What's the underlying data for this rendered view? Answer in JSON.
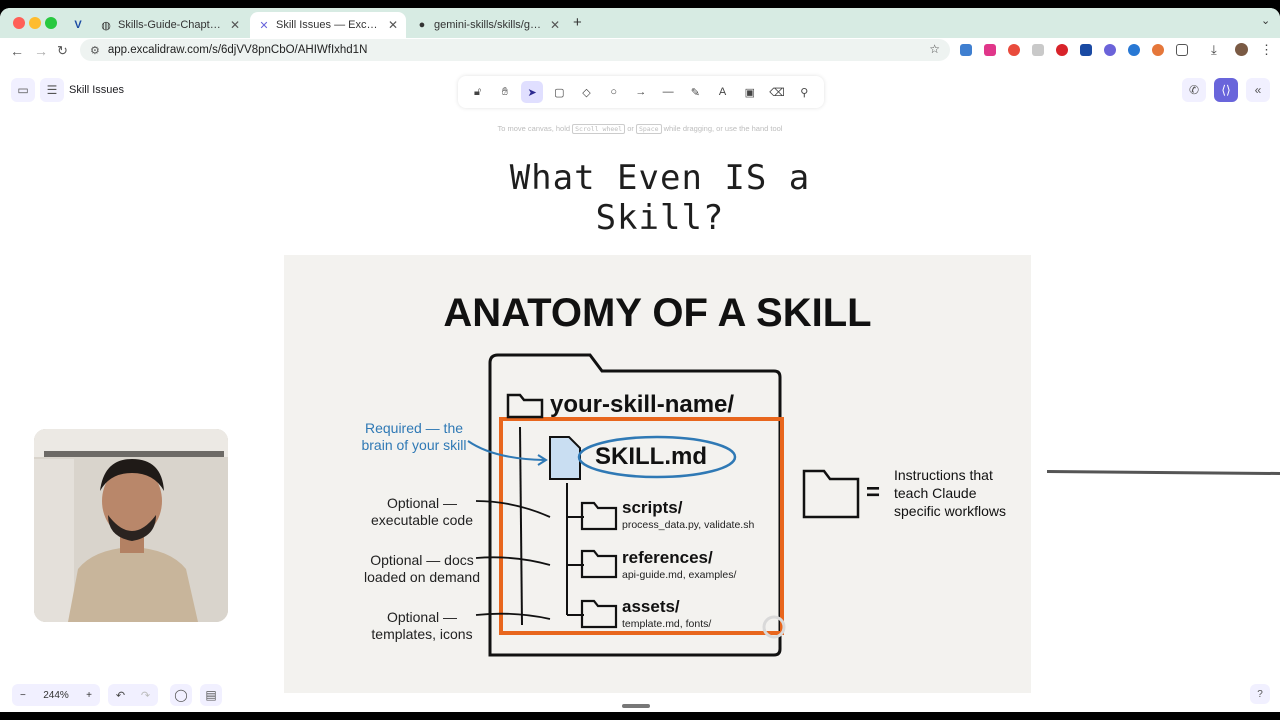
{
  "browser": {
    "tabs": [
      {
        "label": "",
        "icon": "vercel-icon"
      },
      {
        "label": "Skills-Guide-Chapter-Overvi",
        "icon": "globe-icon"
      },
      {
        "label": "Skill Issues — Excalidraw Plus",
        "icon": "excalidraw-icon"
      },
      {
        "label": "gemini-skills/skills/gemini-ap",
        "icon": "github-icon"
      }
    ],
    "url": "app.excalidraw.com/s/6djVV8pnCbO/AHIWfIxhd1N"
  },
  "app": {
    "doc_name": "Skill Issues",
    "hint": {
      "prefix": "To move canvas, hold",
      "key1": "Scroll wheel",
      "mid": "or",
      "key2": "Space",
      "suffix": "while dragging, or use the hand tool"
    },
    "canvas_title": "What Even IS a Skill?",
    "zoom": "244%",
    "accent_color": "#6965db"
  },
  "slide": {
    "title": "ANATOMY OF A SKILL",
    "root_folder": "your-skill-name/",
    "skill_file": "SKILL.md",
    "scripts": {
      "name": "scripts/",
      "files": "process_data.py, validate.sh"
    },
    "references": {
      "name": "references/",
      "files": "api-guide.md, examples/"
    },
    "assets": {
      "name": "assets/",
      "files": "template.md, fonts/"
    },
    "annotations": {
      "required": [
        "Required — the",
        "brain of your skill"
      ],
      "scripts": [
        "Optional —",
        "executable code"
      ],
      "references": [
        "Optional — docs",
        "loaded on demand"
      ],
      "assets": [
        "Optional —",
        "templates, icons"
      ]
    },
    "equals": "=",
    "instructions": [
      "Instructions that",
      "teach Claude",
      "specific workflows"
    ],
    "highlight_color": "#e8661d",
    "skill_color": "#2f79b5"
  }
}
